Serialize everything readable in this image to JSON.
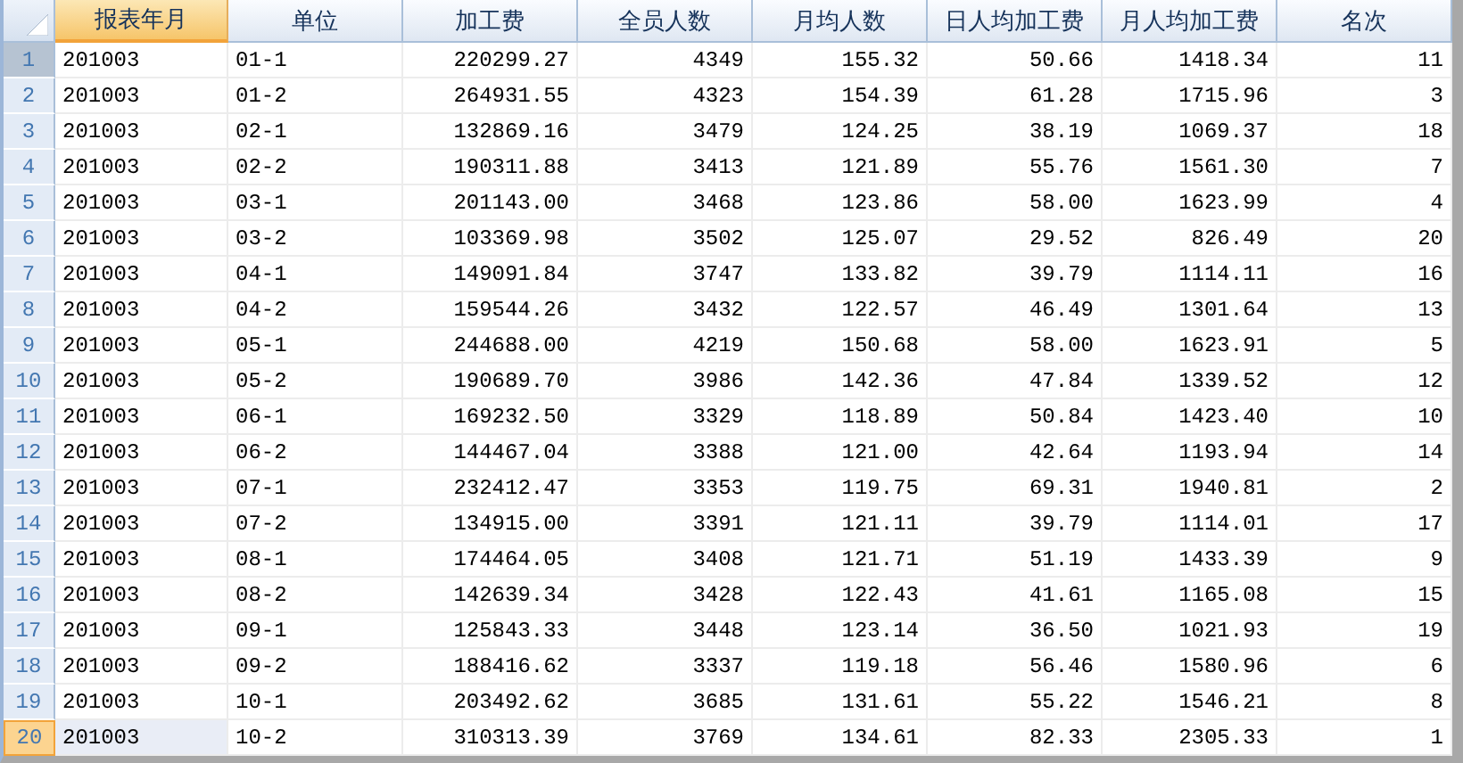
{
  "table": {
    "columns": [
      {
        "label": "报表年月",
        "kind": "text",
        "selected": true
      },
      {
        "label": "单位",
        "kind": "text",
        "selected": false
      },
      {
        "label": "加工费",
        "kind": "number",
        "selected": false
      },
      {
        "label": "全员人数",
        "kind": "number",
        "selected": false
      },
      {
        "label": "月均人数",
        "kind": "number",
        "selected": false
      },
      {
        "label": "日人均加工费",
        "kind": "number",
        "selected": false
      },
      {
        "label": "月人均加工费",
        "kind": "number",
        "selected": false
      },
      {
        "label": "名次",
        "kind": "number",
        "selected": false
      }
    ],
    "rows": [
      {
        "number": "1",
        "focused": true,
        "selected": false,
        "cells": [
          "201003",
          "01-1",
          "220299.27",
          "4349",
          "155.32",
          "50.66",
          "1418.34",
          "11"
        ]
      },
      {
        "number": "2",
        "focused": false,
        "selected": false,
        "cells": [
          "201003",
          "01-2",
          "264931.55",
          "4323",
          "154.39",
          "61.28",
          "1715.96",
          "3"
        ]
      },
      {
        "number": "3",
        "focused": false,
        "selected": false,
        "cells": [
          "201003",
          "02-1",
          "132869.16",
          "3479",
          "124.25",
          "38.19",
          "1069.37",
          "18"
        ]
      },
      {
        "number": "4",
        "focused": false,
        "selected": false,
        "cells": [
          "201003",
          "02-2",
          "190311.88",
          "3413",
          "121.89",
          "55.76",
          "1561.30",
          "7"
        ]
      },
      {
        "number": "5",
        "focused": false,
        "selected": false,
        "cells": [
          "201003",
          "03-1",
          "201143.00",
          "3468",
          "123.86",
          "58.00",
          "1623.99",
          "4"
        ]
      },
      {
        "number": "6",
        "focused": false,
        "selected": false,
        "cells": [
          "201003",
          "03-2",
          "103369.98",
          "3502",
          "125.07",
          "29.52",
          "826.49",
          "20"
        ]
      },
      {
        "number": "7",
        "focused": false,
        "selected": false,
        "cells": [
          "201003",
          "04-1",
          "149091.84",
          "3747",
          "133.82",
          "39.79",
          "1114.11",
          "16"
        ]
      },
      {
        "number": "8",
        "focused": false,
        "selected": false,
        "cells": [
          "201003",
          "04-2",
          "159544.26",
          "3432",
          "122.57",
          "46.49",
          "1301.64",
          "13"
        ]
      },
      {
        "number": "9",
        "focused": false,
        "selected": false,
        "cells": [
          "201003",
          "05-1",
          "244688.00",
          "4219",
          "150.68",
          "58.00",
          "1623.91",
          "5"
        ]
      },
      {
        "number": "10",
        "focused": false,
        "selected": false,
        "cells": [
          "201003",
          "05-2",
          "190689.70",
          "3986",
          "142.36",
          "47.84",
          "1339.52",
          "12"
        ]
      },
      {
        "number": "11",
        "focused": false,
        "selected": false,
        "cells": [
          "201003",
          "06-1",
          "169232.50",
          "3329",
          "118.89",
          "50.84",
          "1423.40",
          "10"
        ]
      },
      {
        "number": "12",
        "focused": false,
        "selected": false,
        "cells": [
          "201003",
          "06-2",
          "144467.04",
          "3388",
          "121.00",
          "42.64",
          "1193.94",
          "14"
        ]
      },
      {
        "number": "13",
        "focused": false,
        "selected": false,
        "cells": [
          "201003",
          "07-1",
          "232412.47",
          "3353",
          "119.75",
          "69.31",
          "1940.81",
          "2"
        ]
      },
      {
        "number": "14",
        "focused": false,
        "selected": false,
        "cells": [
          "201003",
          "07-2",
          "134915.00",
          "3391",
          "121.11",
          "39.79",
          "1114.01",
          "17"
        ]
      },
      {
        "number": "15",
        "focused": false,
        "selected": false,
        "cells": [
          "201003",
          "08-1",
          "174464.05",
          "3408",
          "121.71",
          "51.19",
          "1433.39",
          "9"
        ]
      },
      {
        "number": "16",
        "focused": false,
        "selected": false,
        "cells": [
          "201003",
          "08-2",
          "142639.34",
          "3428",
          "122.43",
          "41.61",
          "1165.08",
          "15"
        ]
      },
      {
        "number": "17",
        "focused": false,
        "selected": false,
        "cells": [
          "201003",
          "09-1",
          "125843.33",
          "3448",
          "123.14",
          "36.50",
          "1021.93",
          "19"
        ]
      },
      {
        "number": "18",
        "focused": false,
        "selected": false,
        "cells": [
          "201003",
          "09-2",
          "188416.62",
          "3337",
          "119.18",
          "56.46",
          "1580.96",
          "6"
        ]
      },
      {
        "number": "19",
        "focused": false,
        "selected": false,
        "cells": [
          "201003",
          "10-1",
          "203492.62",
          "3685",
          "131.61",
          "55.22",
          "1546.21",
          "8"
        ]
      },
      {
        "number": "20",
        "focused": false,
        "selected": true,
        "cells": [
          "201003",
          "10-2",
          "310313.39",
          "3769",
          "134.61",
          "82.33",
          "2305.33",
          "1"
        ]
      }
    ]
  }
}
